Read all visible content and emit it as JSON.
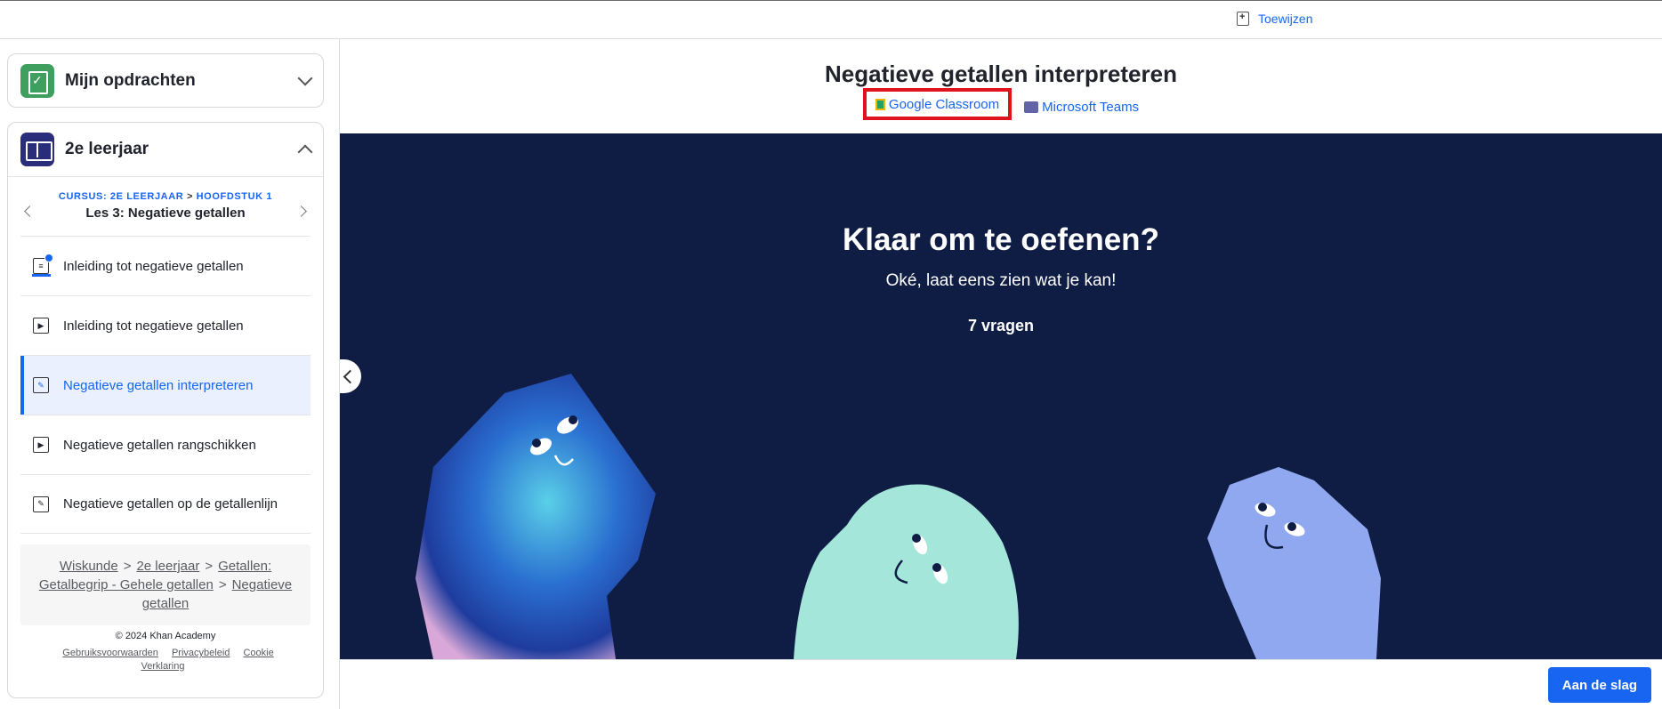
{
  "topbar": {
    "assign_label": "Toewijzen"
  },
  "sidebar": {
    "my_assignments": "Mijn opdrachten",
    "course_title": "2e leerjaar",
    "crumb": {
      "course": "CURSUS: 2E LEERJAAR",
      "sep": ">",
      "chapter": "HOOFDSTUK 1"
    },
    "lesson_name": "Les 3: Negatieve getallen",
    "items": [
      {
        "label": "Inleiding tot negatieve getallen",
        "type": "article"
      },
      {
        "label": "Inleiding tot negatieve getallen",
        "type": "video"
      },
      {
        "label": "Negatieve getallen interpreteren",
        "type": "exercise"
      },
      {
        "label": "Negatieve getallen rangschikken",
        "type": "video"
      },
      {
        "label": "Negatieve getallen op de getallenlijn",
        "type": "exercise"
      }
    ],
    "breadcrumb": [
      "Wiskunde",
      "2e leerjaar",
      "Getallen: Getalbegrip - Gehele getallen",
      "Negatieve getallen"
    ],
    "breadcrumb_sep": ">",
    "copyright": "© 2024 Khan Academy",
    "footer_links": [
      "Gebruiksvoorwaarden",
      "Privacybeleid",
      "Cookie Verklaring"
    ]
  },
  "main": {
    "title": "Negatieve getallen interpreteren",
    "share": {
      "google": "Google Classroom",
      "teams": "Microsoft Teams"
    },
    "heading": "Klaar om te oefenen?",
    "subheading": "Oké, laat eens zien wat je kan!",
    "question_count": "7 vragen",
    "start_label": "Aan de slag"
  },
  "colors": {
    "accent": "#1865f2",
    "stage_bg": "#0f1d45",
    "highlight": "#e0121b"
  }
}
